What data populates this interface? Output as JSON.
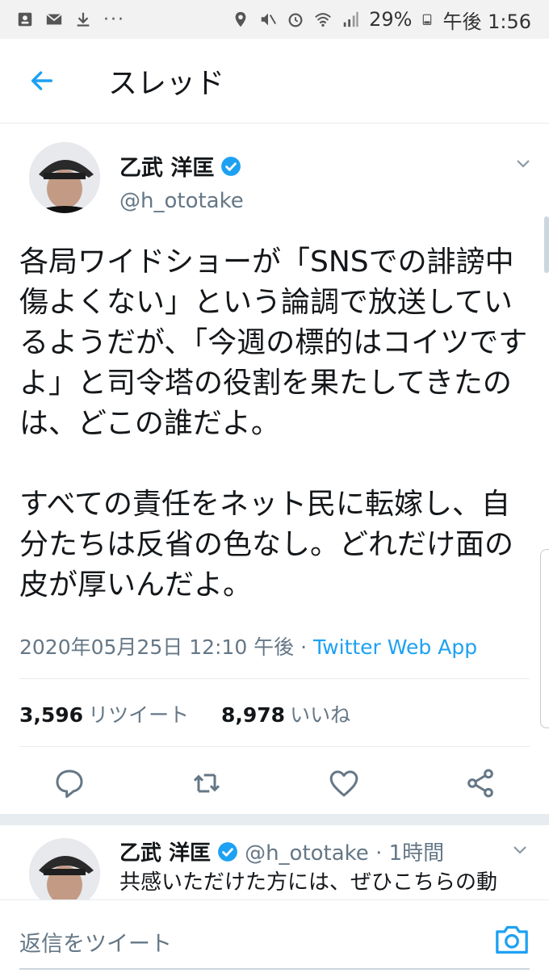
{
  "status_bar": {
    "battery": "29%",
    "time": "午後 1:56",
    "icons": [
      "contacts-icon",
      "mail-icon",
      "download-icon",
      "more-icon",
      "location-icon",
      "mute-icon",
      "alarm-icon",
      "wifi-icon",
      "signal-icon",
      "battery-icon"
    ]
  },
  "header": {
    "title": "スレッド"
  },
  "tweet": {
    "name": "乙武 洋匡",
    "handle": "@h_ototake",
    "text": "各局ワイドショーが「SNSでの誹謗中傷よくない」という論調で放送しているようだが、「今週の標的はコイツですよ」と司令塔の役割を果たしてきたのは、どこの誰だよ。\n\nすべての責任をネット民に転嫁し、自分たちは反省の色なし。どれだけ面の皮が厚いんだよ。",
    "timestamp": "2020年05月25日 12:10 午後",
    "separator": "·",
    "source": "Twitter Web App",
    "retweets": "3,596",
    "retweets_label": "リツイート",
    "likes": "8,978",
    "likes_label": "いいね"
  },
  "reply": {
    "name": "乙武 洋匡",
    "handle_time": "@h_ototake · 1時間",
    "text": "共感いただけた方には、ぜひこちらの動"
  },
  "composer": {
    "placeholder": "返信をツイート"
  },
  "colors": {
    "accent": "#1da1f2",
    "secondary_text": "#657786",
    "divider": "#e6ecf0"
  }
}
